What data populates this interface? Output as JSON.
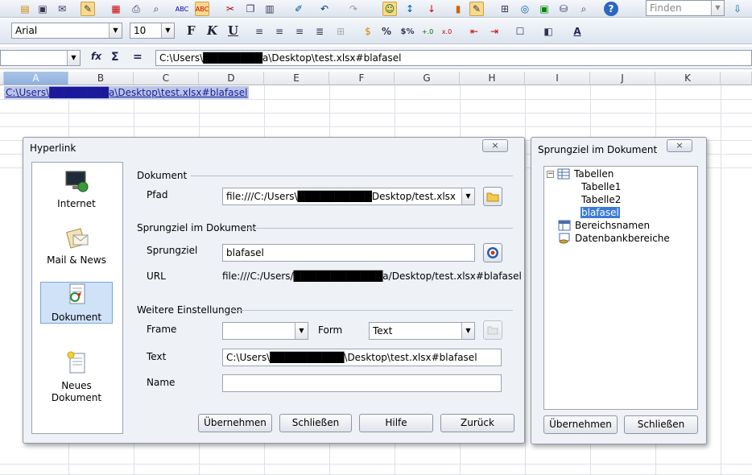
{
  "toolbar": {
    "find_placeholder": "Finden",
    "font_name": "Arial",
    "font_size": "10",
    "bold": "F",
    "italic": "K",
    "underline": "U",
    "percent": "%",
    "currency": "$%"
  },
  "formula_bar": {
    "cell_ref": "",
    "fx": "fx",
    "sum": "Σ",
    "equals": "=",
    "content": "C:\\Users\\████████a\\Desktop\\test.xlsx#blafasel"
  },
  "grid": {
    "columns": [
      "A",
      "B",
      "C",
      "D",
      "E",
      "F",
      "G",
      "H",
      "I",
      "J",
      "K"
    ],
    "cell_a1": "C:\\Users\\████████a\\Desktop\\test.xlsx#blafasel"
  },
  "hyperlink": {
    "title": "Hyperlink",
    "close": "×",
    "categories": [
      "Internet",
      "Mail & News",
      "Dokument",
      "Neues\nDokument"
    ],
    "section_dokument": "Dokument",
    "pfad_label": "Pfad",
    "pfad_value": "file:///C:/Users\\██████████Desktop/test.xlsx",
    "section_target": "Sprungziel im Dokument",
    "sprungziel_label": "Sprungziel",
    "sprungziel_value": "blafasel",
    "url_label": "URL",
    "url_value": "file:///C:/Users/████████████a/Desktop/test.xlsx#blafasel",
    "section_more": "Weitere Einstellungen",
    "frame_label": "Frame",
    "frame_value": "",
    "form_label": "Form",
    "form_value": "Text",
    "text_label": "Text",
    "text_value": "C:\\Users\\██████████\\Desktop\\test.xlsx#blafasel",
    "name_label": "Name",
    "name_value": "",
    "btn_apply": "Übernehmen",
    "btn_close": "Schließen",
    "btn_help": "Hilfe",
    "btn_back": "Zurück"
  },
  "target_dialog": {
    "title": "Sprungziel im Dokument",
    "close": "×",
    "tree": {
      "tables": "Tabellen",
      "items": [
        "Tabelle1",
        "Tabelle2",
        "blafasel"
      ],
      "ranges": "Bereichsnamen",
      "db_ranges": "Datenbankbereiche"
    },
    "btn_apply": "Übernehmen",
    "btn_close": "Schließen"
  }
}
